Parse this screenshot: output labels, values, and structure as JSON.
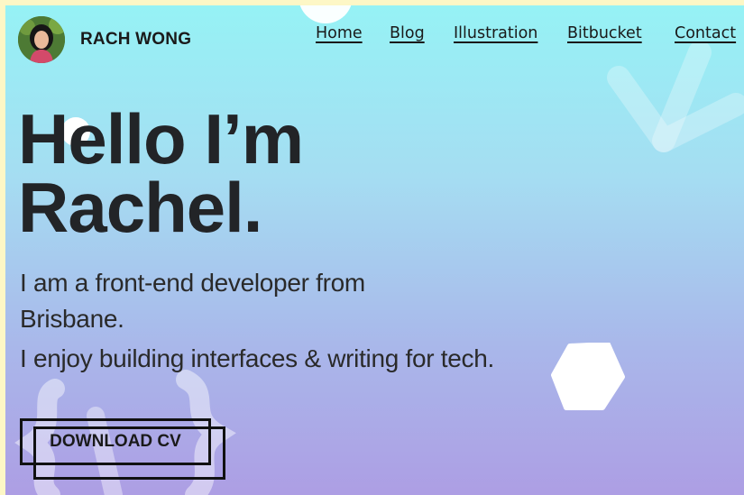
{
  "header": {
    "brand": "RACH WONG",
    "nav": [
      "Home",
      "Blog",
      "Illustration",
      "Bitbucket",
      "Contact"
    ]
  },
  "hero": {
    "headline_line1": "Hello I’m",
    "headline_line2": "Rachel.",
    "intro_line1": "I am a front-end developer from Brisbane.",
    "intro_line2": "I enjoy building interfaces & writing for tech.",
    "cta": "DOWNLOAD CV"
  },
  "colors": {
    "page_border": "#fdf7c6",
    "gradient_top": "#96f2f5",
    "gradient_bottom": "#ad9ee4",
    "text": "#222427"
  }
}
